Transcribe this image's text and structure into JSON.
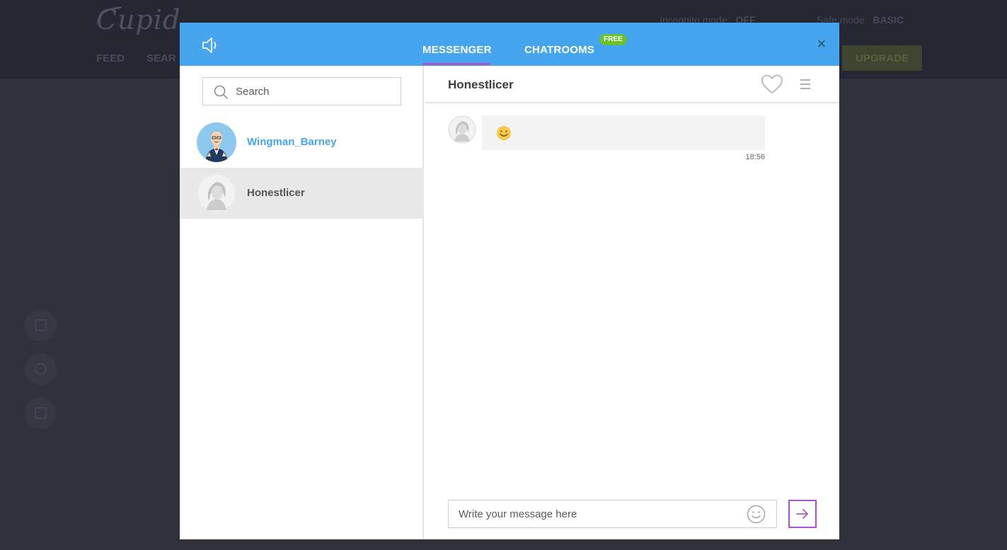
{
  "background": {
    "logo": "Cupid",
    "nav": [
      "FEED",
      "SEAR"
    ],
    "incognito_label": "Incognito mode:",
    "incognito_value": "OFF",
    "safe_label": "Safe mode:",
    "safe_value": "BASIC",
    "upgrade_label": "UPGRADE"
  },
  "header": {
    "tabs": [
      {
        "label": "MESSENGER",
        "active": true
      },
      {
        "label": "CHATROOMS",
        "badge": "FREE"
      }
    ],
    "close_label": "×",
    "accent_color": "#45a5ef",
    "active_tab_color": "#a855c9",
    "badge_color": "#6cc12d"
  },
  "sidebar": {
    "search_placeholder": "Search",
    "contacts": [
      {
        "name": "Wingman_Barney",
        "selected": false
      },
      {
        "name": "Honestlicer",
        "selected": true
      }
    ]
  },
  "chat": {
    "title": "Honestlicer",
    "messages": [
      {
        "content": "smiley-emoji",
        "time": "18:56"
      }
    ],
    "composer_placeholder": "Write your message here"
  }
}
